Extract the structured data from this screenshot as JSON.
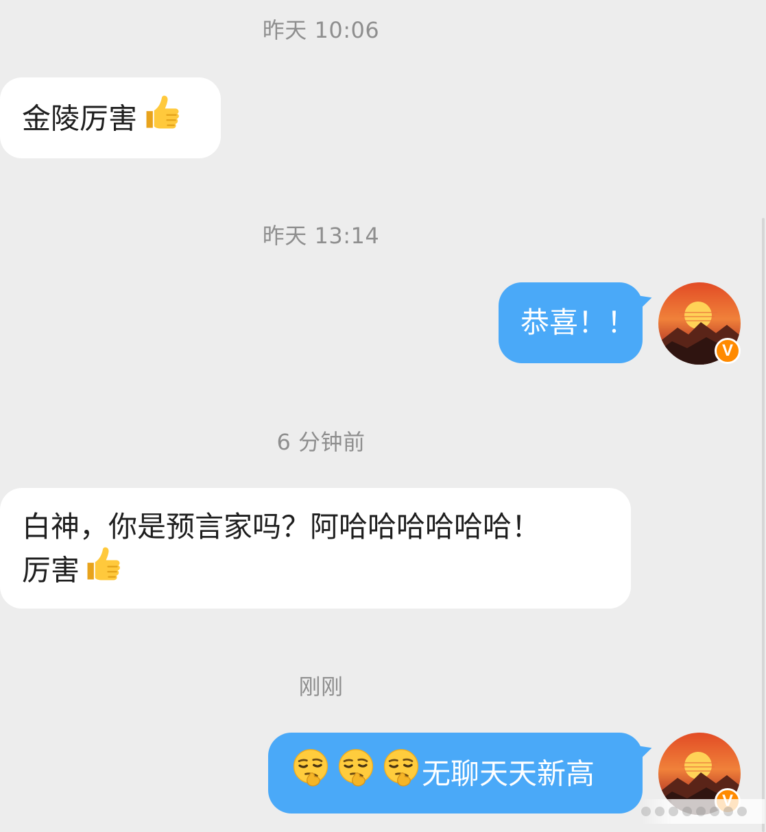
{
  "conversation": {
    "messages": [
      {
        "type": "timestamp",
        "text": "昨天 10:06"
      },
      {
        "type": "incoming",
        "text": "金陵厉害",
        "emoji": "thumbs-up"
      },
      {
        "type": "timestamp",
        "text": "昨天 13:14"
      },
      {
        "type": "outgoing",
        "text": "恭喜！！",
        "avatar": "sunset-mountain-avatar",
        "badge": "V"
      },
      {
        "type": "timestamp",
        "text": "6 分钟前"
      },
      {
        "type": "incoming",
        "line1": "白神，你是预言家吗？阿哈哈哈哈哈哈！",
        "line2": "厉害",
        "emoji": "thumbs-up"
      },
      {
        "type": "timestamp",
        "text": "刚刚"
      },
      {
        "type": "outgoing",
        "emojis": [
          "smirking-face",
          "smirking-face",
          "smirking-face"
        ],
        "text": "无聊天天新高",
        "avatar": "sunset-mountain-avatar",
        "badge": "V"
      }
    ]
  },
  "colors": {
    "background": "#ededed",
    "incoming_bubble": "#ffffff",
    "outgoing_bubble": "#4aa9f8",
    "timestamp_text": "#8e8e8e",
    "verified_badge": "#ff8a00"
  }
}
